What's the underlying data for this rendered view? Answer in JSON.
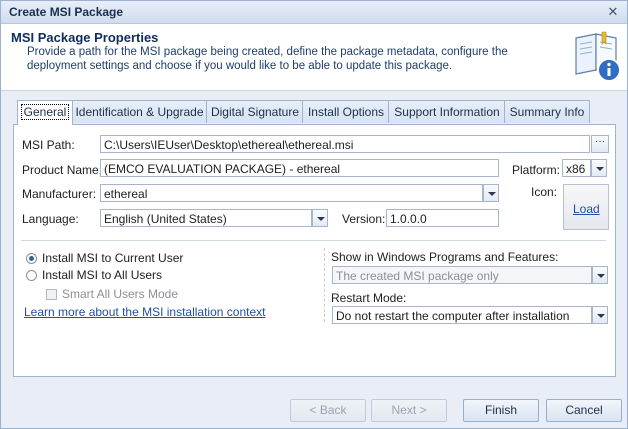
{
  "window": {
    "title": "Create MSI Package",
    "close_glyph": "✕"
  },
  "header": {
    "title": "MSI Package Properties",
    "description": "Provide a path for the MSI package being created, define the package metadata, configure the deployment settings and choose if you would like to be able to update this package.",
    "icon": "book-info-icon"
  },
  "tabs": [
    {
      "label": "General",
      "active": true
    },
    {
      "label": "Identification & Upgrade",
      "active": false
    },
    {
      "label": "Digital Signature",
      "active": false
    },
    {
      "label": "Install Options",
      "active": false
    },
    {
      "label": "Support Information",
      "active": false
    },
    {
      "label": "Summary Info",
      "active": false
    }
  ],
  "general": {
    "msi_path": {
      "label": "MSI Path:",
      "value": "C:\\Users\\IEUser\\Desktop\\ethereal\\ethereal.msi",
      "browse_label": "···"
    },
    "product_name": {
      "label": "Product Name:",
      "value": "(EMCO EVALUATION PACKAGE) - ethereal"
    },
    "platform": {
      "label": "Platform:",
      "value": "x86"
    },
    "manufacturer": {
      "label": "Manufacturer:",
      "value": "ethereal"
    },
    "icon": {
      "label": "Icon:",
      "load_label": "Load"
    },
    "language": {
      "label": "Language:",
      "value": "English (United States)"
    },
    "version": {
      "label": "Version:",
      "value": "1.0.0.0"
    },
    "install_scope": {
      "current_user": "Install MSI to Current User",
      "all_users": "Install MSI to All Users",
      "smart_all_users": "Smart All Users Mode",
      "learn_more": "Learn more about the MSI installation context"
    },
    "show_in_programs": {
      "label": "Show in Windows Programs and Features:",
      "value": "The created MSI package only"
    },
    "restart_mode": {
      "label": "Restart Mode:",
      "value": "Do not restart the computer after installation"
    }
  },
  "buttons": {
    "back": "< Back",
    "next": "Next >",
    "finish": "Finish",
    "cancel": "Cancel"
  },
  "colors": {
    "accent": "#1f4fa8",
    "header_title": "#0f2d5a",
    "dialog_bg": "#e9eef6"
  }
}
